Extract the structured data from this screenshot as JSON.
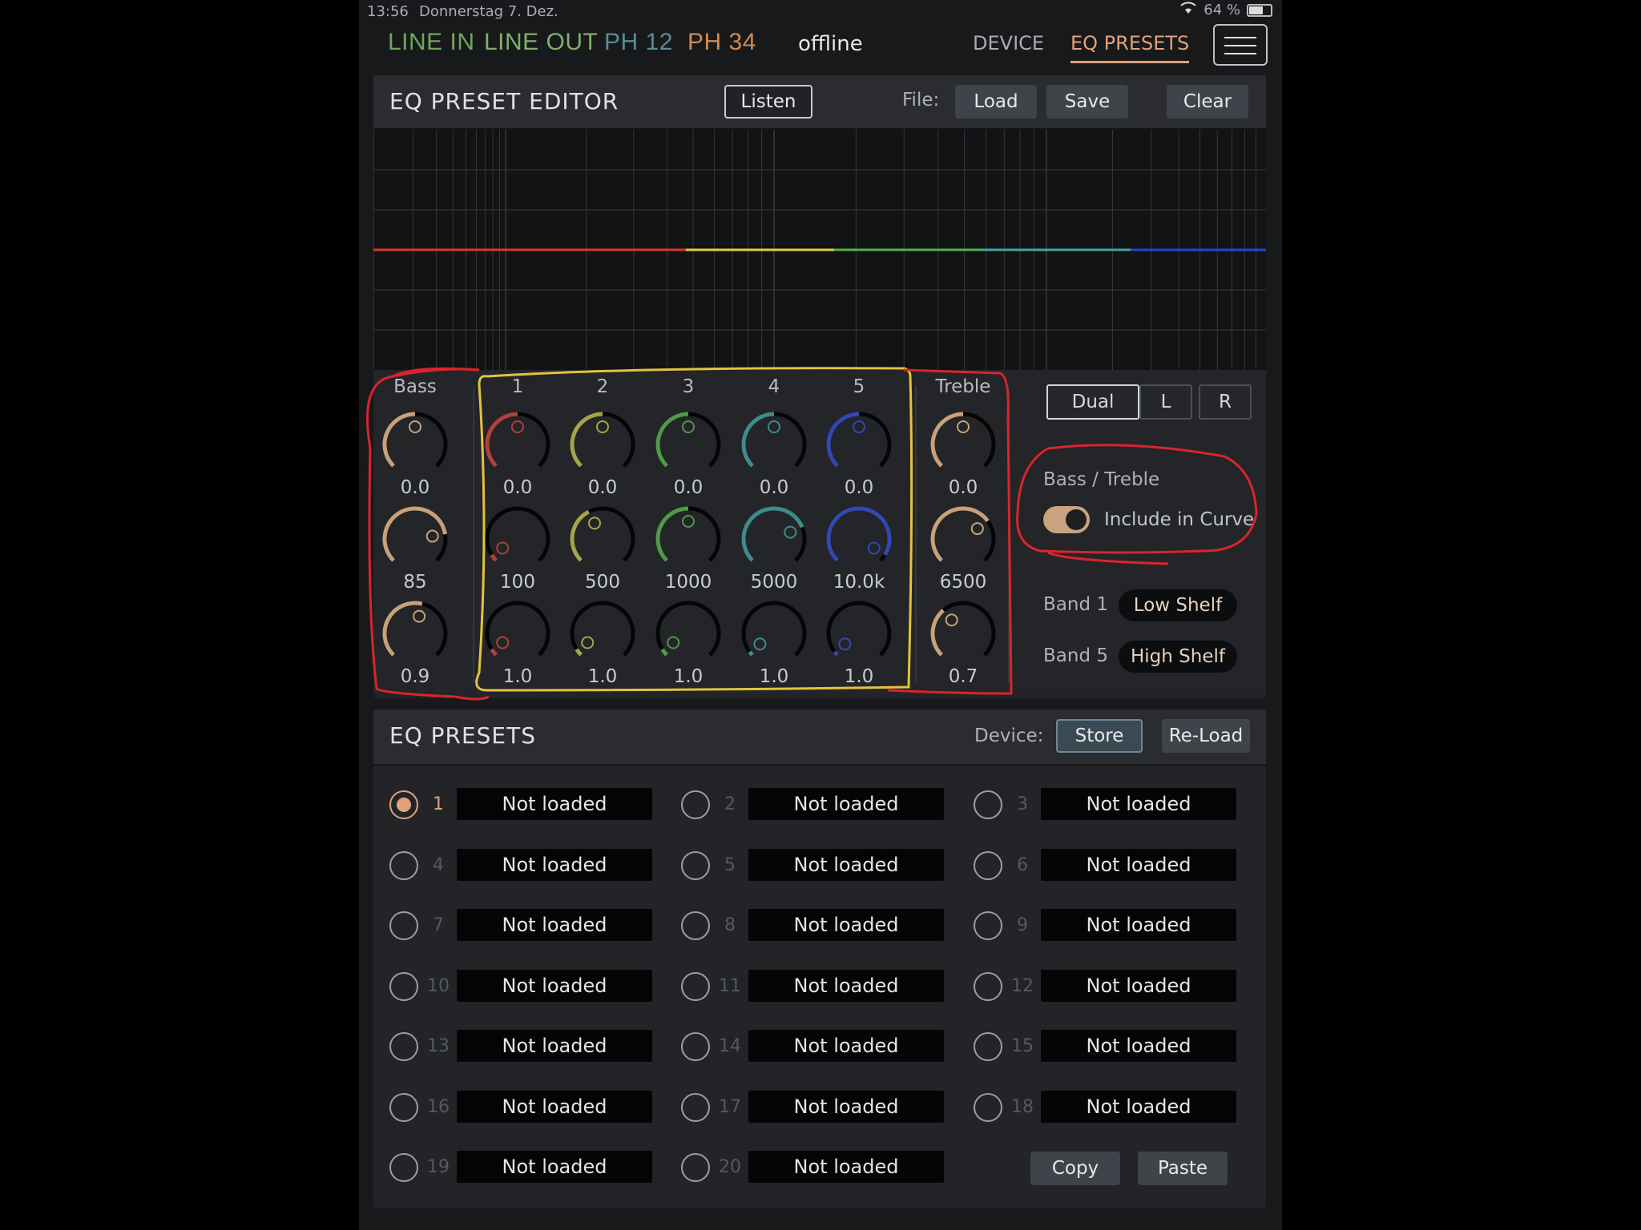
{
  "statusbar": {
    "time": "13:56",
    "date": "Donnerstag 7. Dez.",
    "battery": "64 %"
  },
  "nav": {
    "tabs": [
      {
        "label": "LINE IN",
        "color": "#6fa85a"
      },
      {
        "label": "LINE OUT",
        "color": "#7fb06a"
      },
      {
        "label": "PH 12",
        "color": "#5b8b97"
      },
      {
        "label": "PH 34",
        "color": "#d08a50"
      }
    ],
    "status": "offline",
    "device_label": "DEVICE",
    "presets_label": "EQ PRESETS"
  },
  "editor": {
    "title": "EQ PRESET EDITOR",
    "listen_label": "Listen",
    "file_label": "File:",
    "load_label": "Load",
    "save_label": "Save",
    "clear_label": "Clear",
    "curve_colors": [
      "#e0322e",
      "#d9d43a",
      "#4fb548",
      "#3ea6a0",
      "#2b3fd6"
    ],
    "bass": {
      "label": "Bass",
      "gain": "0.0",
      "freq": "85",
      "q": "0.9"
    },
    "treble": {
      "label": "Treble",
      "gain": "0.0",
      "freq": "6500",
      "q": "0.7"
    },
    "bands": [
      {
        "label": "1",
        "gain": "0.0",
        "freq": "100",
        "q": "1.0",
        "color": "#b0413c"
      },
      {
        "label": "2",
        "gain": "0.0",
        "freq": "500",
        "q": "1.0",
        "color": "#a6a44a"
      },
      {
        "label": "3",
        "gain": "0.0",
        "freq": "1000",
        "q": "1.0",
        "color": "#4e9a47"
      },
      {
        "label": "4",
        "gain": "0.0",
        "freq": "5000",
        "q": "1.0",
        "color": "#3e8c8c"
      },
      {
        "label": "5",
        "gain": "0.0",
        "freq": "10.0k",
        "q": "1.0",
        "color": "#3347b4"
      }
    ],
    "mode": {
      "dual": "Dual",
      "left": "L",
      "right": "R"
    },
    "bass_treble_label": "Bass / Treble",
    "include_curve_label": "Include in Curve",
    "band1_label": "Band 1",
    "band1_type": "Low Shelf",
    "band5_label": "Band 5",
    "band5_type": "High Shelf"
  },
  "presets": {
    "title": "EQ PRESETS",
    "device_label": "Device:",
    "store_label": "Store",
    "reload_label": "Re-Load",
    "copy_label": "Copy",
    "paste_label": "Paste",
    "selected": 1,
    "items": [
      {
        "num": "1",
        "name": "Not loaded"
      },
      {
        "num": "2",
        "name": "Not loaded"
      },
      {
        "num": "3",
        "name": "Not loaded"
      },
      {
        "num": "4",
        "name": "Not loaded"
      },
      {
        "num": "5",
        "name": "Not loaded"
      },
      {
        "num": "6",
        "name": "Not loaded"
      },
      {
        "num": "7",
        "name": "Not loaded"
      },
      {
        "num": "8",
        "name": "Not loaded"
      },
      {
        "num": "9",
        "name": "Not loaded"
      },
      {
        "num": "10",
        "name": "Not loaded"
      },
      {
        "num": "11",
        "name": "Not loaded"
      },
      {
        "num": "12",
        "name": "Not loaded"
      },
      {
        "num": "13",
        "name": "Not loaded"
      },
      {
        "num": "14",
        "name": "Not loaded"
      },
      {
        "num": "15",
        "name": "Not loaded"
      },
      {
        "num": "16",
        "name": "Not loaded"
      },
      {
        "num": "17",
        "name": "Not loaded"
      },
      {
        "num": "18",
        "name": "Not loaded"
      },
      {
        "num": "19",
        "name": "Not loaded"
      },
      {
        "num": "20",
        "name": "Not loaded"
      }
    ]
  }
}
